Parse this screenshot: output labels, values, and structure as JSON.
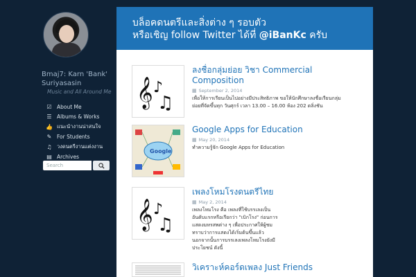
{
  "sidebar": {
    "site_title": "Bmaj7: Karn 'Bank' Suriyasasin",
    "tagline": "Music and All Around Me",
    "menu": [
      {
        "icon": "check-square-icon",
        "label": "About Me"
      },
      {
        "icon": "list-icon",
        "label": "Albums & Works"
      },
      {
        "icon": "thumbs-up-icon",
        "label": "แนะนำงานน่าสนใจ"
      },
      {
        "icon": "pencil-icon",
        "label": "For Students"
      },
      {
        "icon": "music-note-icon",
        "label": "วงดนตรีงานแต่งงาน"
      },
      {
        "icon": "archive-icon",
        "label": "Archives"
      }
    ],
    "search": {
      "placeholder": "Search"
    }
  },
  "banner": {
    "line1": "บล็อคดนตรีและสิ่งต่าง ๆ รอบตัว",
    "line2_prefix": "หรือเชิญ follow Twitter ได้ที่",
    "line2_handle": "@iBanKc",
    "line2_suffix": "ครับ"
  },
  "posts": [
    {
      "title": "ลงชื่อกลุ่มย่อย วิชา Commercial Composition",
      "date": "September 2, 2014",
      "excerpt": "เพื่อให้การเรียนเป็นไปอย่างมีประสิทธิภาพ ขอให้นักศึกษาลงชื่อเรียนกลุ่มย่อยที่จัดขึ้นทุก วันศุกร์ เวลา 13.00 – 16.00 ห้อง 202 ตลิ่งชัน",
      "thumb": "music-notes-icon"
    },
    {
      "title": "Google Apps for Education",
      "date": "May 20, 2014",
      "excerpt": "ทำความรู้จัก Google Apps for Education",
      "thumb": "google-apps-diagram"
    },
    {
      "title": "เพลงโหมโรงดนตรีไทย",
      "date": "May 2, 2014",
      "excerpt": "เพลงโหมโรง คือ เพลงที่ใช้บรรเลงเป็นอันดับแรกหรือเรียกว่า \"เบิกโรง\" ก่อนการแสดงมหรสพต่าง ๆ เพื่อประกาศให้ผู้ชมทราบว่าการแสดงได้เริ่มต้นขึ้นแล้ว นอกจากนั้นการบรรเลงเพลงโหมโรงยังมีประโยชน์ ดังนี้",
      "thumb": "music-notes-icon"
    },
    {
      "title": "วิเคราะห์คอร์ดเพลง Just Friends",
      "date": "",
      "excerpt": "",
      "thumb": "sheet-music-thumbnail"
    }
  ]
}
